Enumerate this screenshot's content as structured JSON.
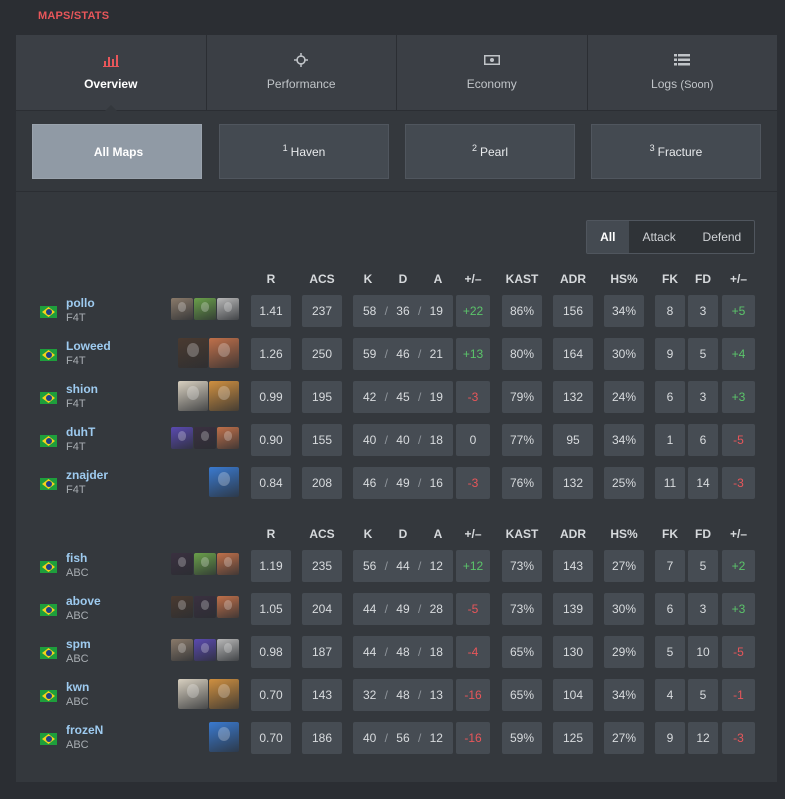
{
  "section_title": "MAPS/STATS",
  "tabs": [
    {
      "label": "Overview",
      "note": "",
      "icon": "bar-chart-icon",
      "active": true
    },
    {
      "label": "Performance",
      "note": "",
      "icon": "crosshair-icon",
      "active": false
    },
    {
      "label": "Economy",
      "note": "",
      "icon": "money-icon",
      "active": false
    },
    {
      "label": "Logs",
      "note": "(Soon)",
      "icon": "list-icon",
      "active": false
    }
  ],
  "maps": [
    {
      "num": "",
      "label": "All Maps",
      "active": true
    },
    {
      "num": "1",
      "label": "Haven",
      "active": false
    },
    {
      "num": "2",
      "label": "Pearl",
      "active": false
    },
    {
      "num": "3",
      "label": "Fracture",
      "active": false
    }
  ],
  "filter": {
    "all": "All",
    "attack": "Attack",
    "defend": "Defend"
  },
  "columns": {
    "r": "R",
    "acs": "ACS",
    "k": "K",
    "d": "D",
    "a": "A",
    "pm": "+/–",
    "kast": "KAST",
    "adr": "ADR",
    "hs": "HS%",
    "fk": "FK",
    "fd": "FD",
    "fpm": "+/–"
  },
  "teams": [
    {
      "players": [
        {
          "name": "pollo",
          "team": "F4T",
          "agents": [
            "#8a7a6a",
            "#6aa04a",
            "#b8b8b8"
          ],
          "r": "1.41",
          "acs": "237",
          "k": "58",
          "d": "36",
          "a": "19",
          "pm": "+22",
          "kast": "86%",
          "adr": "156",
          "hs": "34%",
          "fk": "8",
          "fd": "3",
          "fpm": "+5"
        },
        {
          "name": "Loweed",
          "team": "F4T",
          "agents": [
            "#4a3a30",
            "#c0704a"
          ],
          "r": "1.26",
          "acs": "250",
          "k": "59",
          "d": "46",
          "a": "21",
          "pm": "+13",
          "kast": "80%",
          "adr": "164",
          "hs": "30%",
          "fk": "9",
          "fd": "5",
          "fpm": "+4"
        },
        {
          "name": "shion",
          "team": "F4T",
          "agents": [
            "#d8d0c0",
            "#d09040"
          ],
          "r": "0.99",
          "acs": "195",
          "k": "42",
          "d": "45",
          "a": "19",
          "pm": "-3",
          "kast": "79%",
          "adr": "132",
          "hs": "24%",
          "fk": "6",
          "fd": "3",
          "fpm": "+3"
        },
        {
          "name": "duhT",
          "team": "F4T",
          "agents": [
            "#5a4ab0",
            "#3a3040",
            "#c0704a"
          ],
          "r": "0.90",
          "acs": "155",
          "k": "40",
          "d": "40",
          "a": "18",
          "pm": "0",
          "kast": "77%",
          "adr": "95",
          "hs": "34%",
          "fk": "1",
          "fd": "6",
          "fpm": "-5"
        },
        {
          "name": "znajder",
          "team": "F4T",
          "agents": [
            "#3a7ad0"
          ],
          "r": "0.84",
          "acs": "208",
          "k": "46",
          "d": "49",
          "a": "16",
          "pm": "-3",
          "kast": "76%",
          "adr": "132",
          "hs": "25%",
          "fk": "11",
          "fd": "14",
          "fpm": "-3"
        }
      ]
    },
    {
      "players": [
        {
          "name": "fish",
          "team": "ABC",
          "agents": [
            "#3a3040",
            "#6aa04a",
            "#c0704a"
          ],
          "r": "1.19",
          "acs": "235",
          "k": "56",
          "d": "44",
          "a": "12",
          "pm": "+12",
          "kast": "73%",
          "adr": "143",
          "hs": "27%",
          "fk": "7",
          "fd": "5",
          "fpm": "+2"
        },
        {
          "name": "above",
          "team": "ABC",
          "agents": [
            "#4a3a30",
            "#3a3040",
            "#c0704a"
          ],
          "r": "1.05",
          "acs": "204",
          "k": "44",
          "d": "49",
          "a": "28",
          "pm": "-5",
          "kast": "73%",
          "adr": "139",
          "hs": "30%",
          "fk": "6",
          "fd": "3",
          "fpm": "+3"
        },
        {
          "name": "spm",
          "team": "ABC",
          "agents": [
            "#8a7a6a",
            "#5a4ab0",
            "#b8b8b8"
          ],
          "r": "0.98",
          "acs": "187",
          "k": "44",
          "d": "48",
          "a": "18",
          "pm": "-4",
          "kast": "65%",
          "adr": "130",
          "hs": "29%",
          "fk": "5",
          "fd": "10",
          "fpm": "-5"
        },
        {
          "name": "kwn",
          "team": "ABC",
          "agents": [
            "#d8d0c0",
            "#d09040"
          ],
          "r": "0.70",
          "acs": "143",
          "k": "32",
          "d": "48",
          "a": "13",
          "pm": "-16",
          "kast": "65%",
          "adr": "104",
          "hs": "34%",
          "fk": "4",
          "fd": "5",
          "fpm": "-1"
        },
        {
          "name": "frozeN",
          "team": "ABC",
          "agents": [
            "#3a7ad0"
          ],
          "r": "0.70",
          "acs": "186",
          "k": "40",
          "d": "56",
          "a": "12",
          "pm": "-16",
          "kast": "59%",
          "adr": "125",
          "hs": "27%",
          "fk": "9",
          "fd": "12",
          "fpm": "-3"
        }
      ]
    }
  ]
}
